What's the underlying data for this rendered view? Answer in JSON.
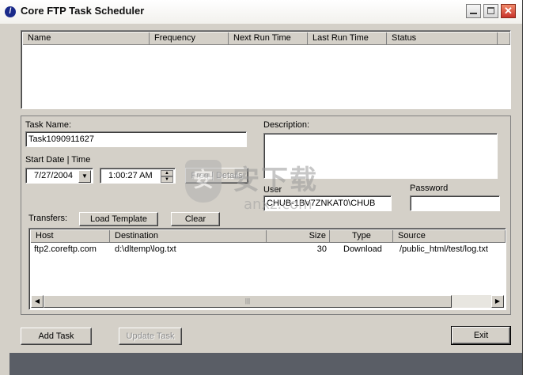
{
  "window": {
    "title": "Core FTP Task Scheduler",
    "icon": "app-logo-icon"
  },
  "titlebar_buttons": {
    "minimize": "minimize-icon",
    "maximize": "maximize-icon",
    "close": "✕"
  },
  "task_list": {
    "columns": [
      "Name",
      "Frequency",
      "Next Run Time",
      "Last Run Time",
      "Status"
    ]
  },
  "form": {
    "task_name_label": "Task Name:",
    "task_name_value": "Task1090911627",
    "start_label": "Start Date | Time",
    "date_value": "7/27/2004",
    "time_value": "1:00:27 AM",
    "freq_button": "Freq | Details",
    "description_label": "Description:",
    "description_value": "",
    "user_label": "User",
    "user_value": "CHUB-1BV7ZNKAT0\\CHUB",
    "password_label": "Password",
    "password_value": "",
    "transfers_label": "Transfers:",
    "load_template_button": "Load Template",
    "clear_button": "Clear"
  },
  "transfers": {
    "columns": [
      "Host",
      "Destination",
      "Size",
      "Type",
      "Source"
    ],
    "rows": [
      {
        "host": "ftp2.coreftp.com",
        "destination": "d:\\dltemp\\log.txt",
        "size": "30",
        "type": "Download",
        "source": "/public_html/test/log.txt"
      }
    ],
    "scroll_left": "◀",
    "scroll_right": "▶",
    "thumb_grip": "|||"
  },
  "actions": {
    "add_task": "Add Task",
    "update_task": "Update Task",
    "exit": "Exit"
  },
  "watermark": {
    "chinese": "安下载",
    "url": "anxz.com",
    "shield_glyph": "安"
  }
}
